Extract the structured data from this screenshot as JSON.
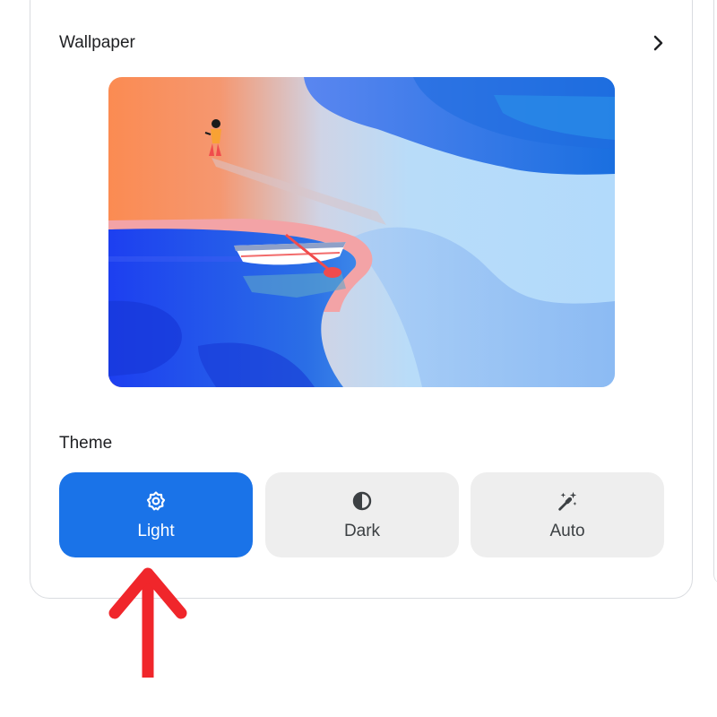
{
  "wallpaper_section": {
    "title": "Wallpaper",
    "open_icon": "chevron-right-icon"
  },
  "theme_section": {
    "title": "Theme",
    "options": [
      {
        "label": "Light",
        "icon": "light-mode-gear-icon",
        "selected": true
      },
      {
        "label": "Dark",
        "icon": "contrast-icon",
        "selected": false
      },
      {
        "label": "Auto",
        "icon": "magic-wand-icon",
        "selected": false
      }
    ]
  },
  "annotation": {
    "arrow_color": "#f0262b"
  },
  "colors": {
    "accent": "#1a73e8",
    "unselected_button": "#eeeeee",
    "card_border": "#dadce0"
  }
}
